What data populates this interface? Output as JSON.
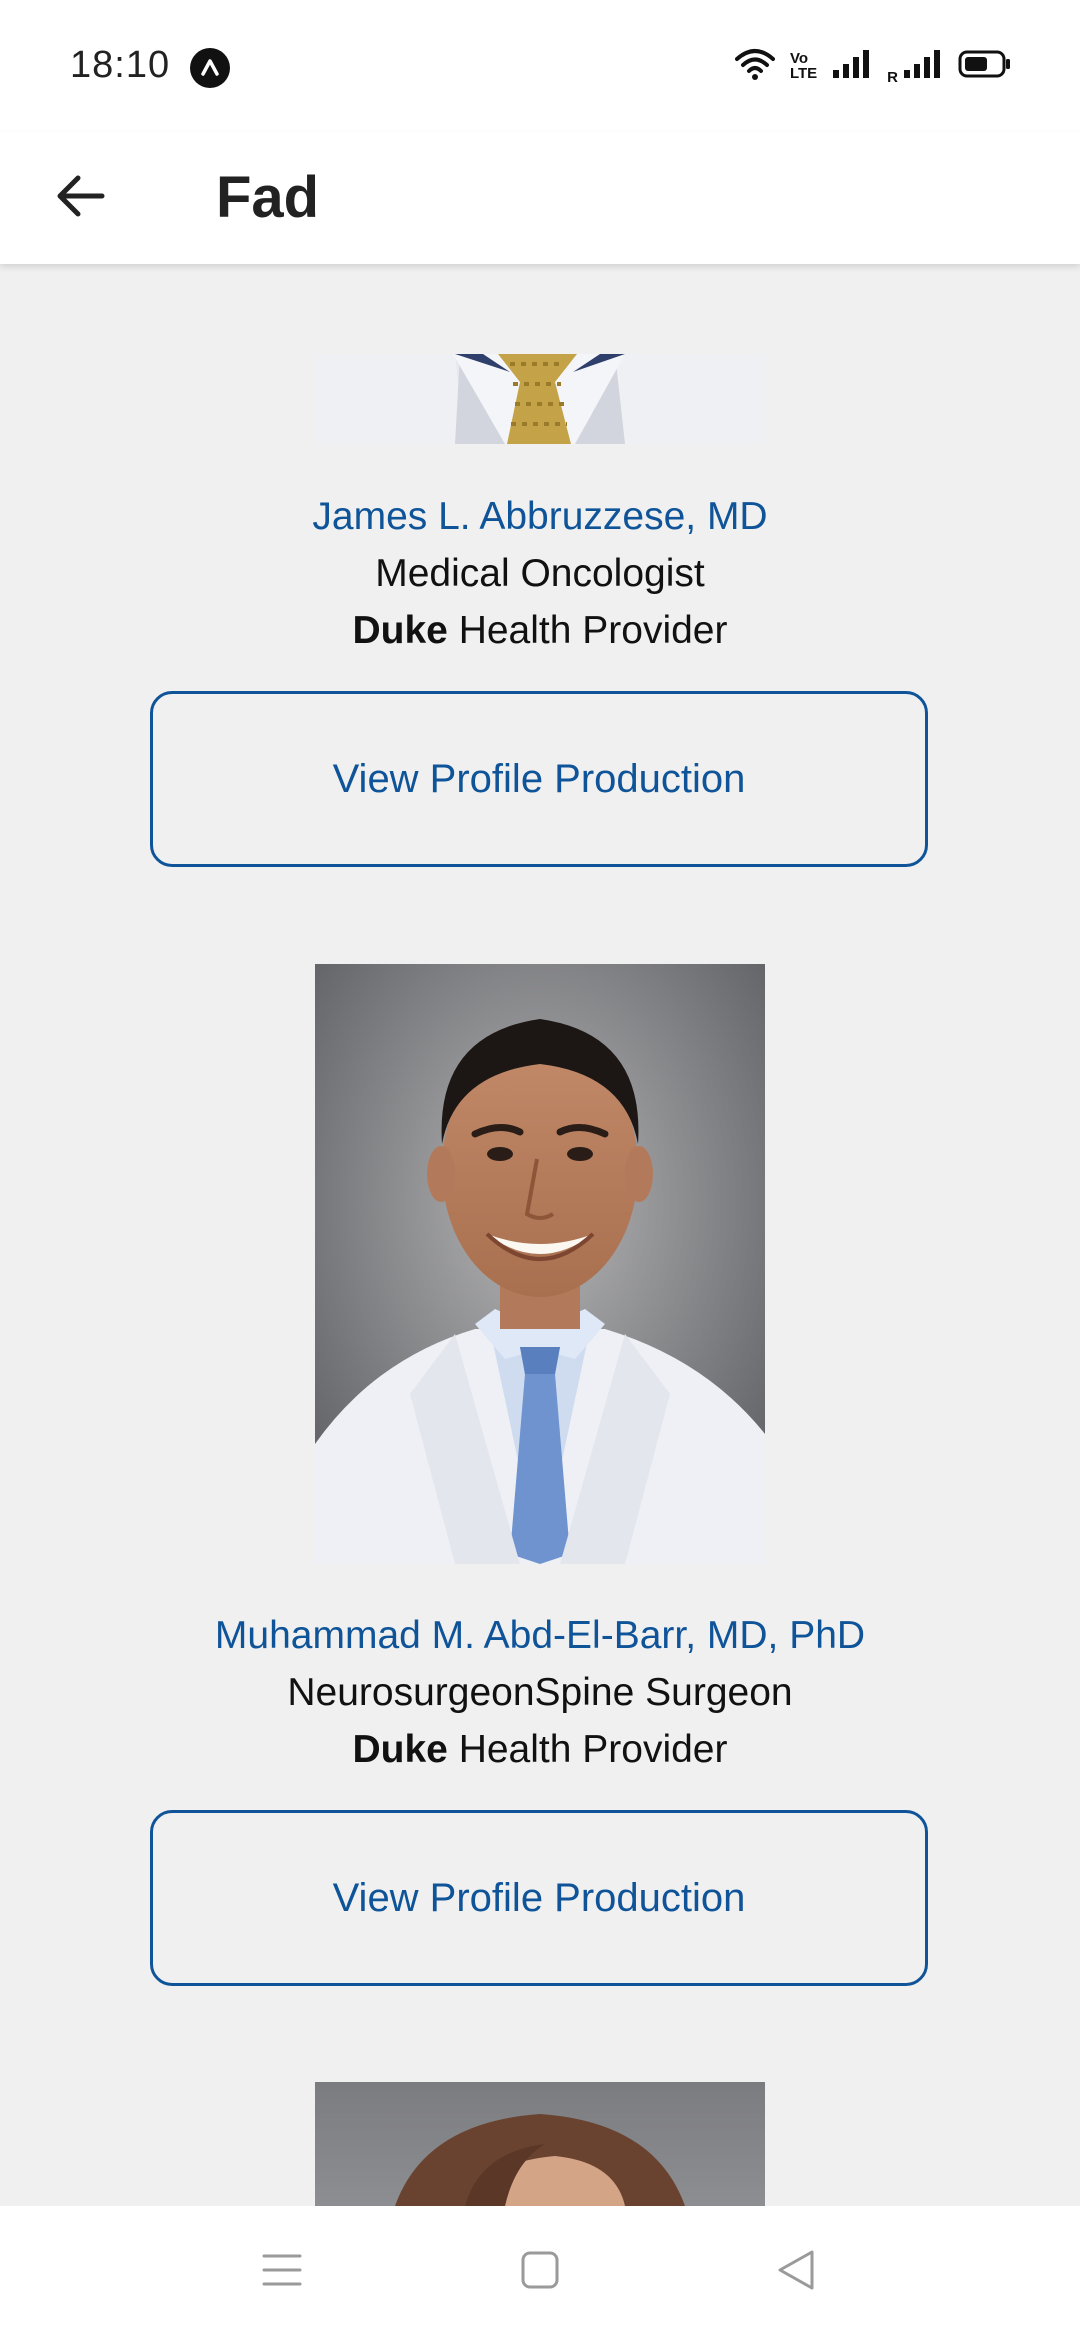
{
  "status_bar": {
    "time": "18:10",
    "app_badge_icon": "app-notification-icon",
    "volte_label_top": "Vo",
    "volte_label_bottom": "LTE",
    "roaming_label": "R",
    "icons": [
      "wifi-icon",
      "volte-icon",
      "signal-icon",
      "roaming-signal-icon",
      "battery-icon"
    ]
  },
  "app_bar": {
    "back_icon": "arrow-left-icon",
    "title": "Fad"
  },
  "providers": [
    {
      "name": "James L. Abbruzzese, MD",
      "specialty": "Medical Oncologist",
      "provider_org": "Duke",
      "provider_suffix": " Health Provider",
      "button_label": "View Profile Production"
    },
    {
      "name": "Muhammad M. Abd-El-Barr, MD, PhD",
      "specialty": "NeurosurgeonSpine Surgeon",
      "provider_org": "Duke",
      "provider_suffix": " Health Provider",
      "button_label": "View Profile Production"
    }
  ],
  "nav_bar": {
    "icons": [
      "menu-icon",
      "home-square-icon",
      "back-triangle-icon"
    ]
  },
  "colors": {
    "accent": "#0f5499",
    "background": "#f0f0f0",
    "surface": "#ffffff"
  }
}
